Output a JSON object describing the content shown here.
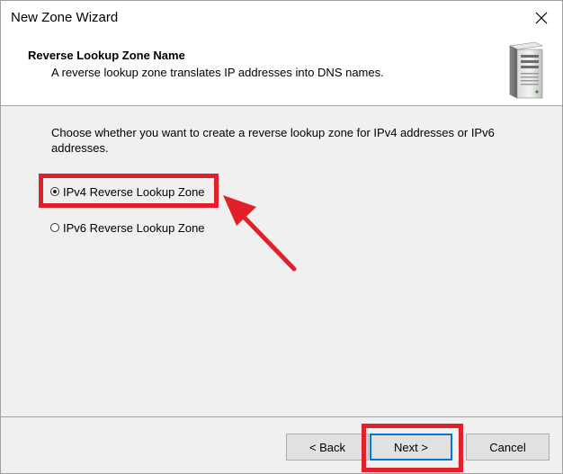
{
  "window": {
    "title": "New Zone Wizard"
  },
  "header": {
    "title": "Reverse Lookup Zone Name",
    "subtitle": "A reverse lookup zone translates IP addresses into DNS names."
  },
  "content": {
    "prompt": "Choose whether you want to create a reverse lookup zone for IPv4 addresses or IPv6 addresses.",
    "options": [
      {
        "label": "IPv4 Reverse Lookup Zone",
        "selected": true
      },
      {
        "label": "IPv6 Reverse Lookup Zone",
        "selected": false
      }
    ]
  },
  "footer": {
    "back_label": "< Back",
    "next_label": "Next >",
    "cancel_label": "Cancel"
  },
  "annotations": {
    "highlight_color": "#e2202a"
  },
  "colors": {
    "focus_border": "#0078d7",
    "dialog_background": "#f0f0f0"
  }
}
